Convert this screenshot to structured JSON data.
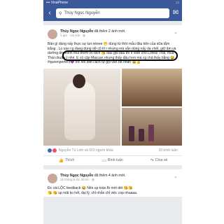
{
  "status": {
    "carrier": "••• VinaPhone",
    "battery": "▭"
  },
  "navbar": {
    "search_text": "Thùy Ngọc Nguyễn"
  },
  "post1": {
    "author": "Thùy Ngọc Nguyễn",
    "action": "đã thêm 2 ảnh mới.",
    "time": "3 giờ · Hà Nội ·",
    "body_pre": "Bản gì dùng nấy thực sự lun nèeee 😁 dùng từ thời mẫu đầu tiên của sữa tắm trắng . Lọ nào cg đang dùng dở cũ kĩ r nhưng mà vẫn dùng nấy da chết, giữ ẩm và dưỡng ẩm",
    "body_circled": "thinh mùi thơm vô địch 😘 dầu gội dầu thì e vote cho Loreal Thái, mua Thái chuẩn ý nhé. E có cặp Maccan nhưng thấy dầu hơn mà cg chả thấy bằng 😂",
    "body_post": "#queenperfect💜 tóc nói biết cách tự gội vẫn rất nhàn 😄👍",
    "reactions_text": "Nguyễn Tú Linh và 503 người khác",
    "comments_count": "33 bình luận",
    "like_label": "Thích",
    "comment_label": "Bình luận",
    "share_label": "Chia sẻ"
  },
  "post2": {
    "author": "Thùy Ngọc Nguyễn",
    "action": "đã thêm 4 ảnh mới.",
    "time": "15 tháng 6 lúc 20:44 ·",
    "line1": "Đc cái LỘC feedback 😂 Nên up toàn fb mới dét 😘😘",
    "line2": "😘 😘 up mãi ko hết, đại lý, chỉ nhẫn chỉ việc cop nhaaaa."
  }
}
